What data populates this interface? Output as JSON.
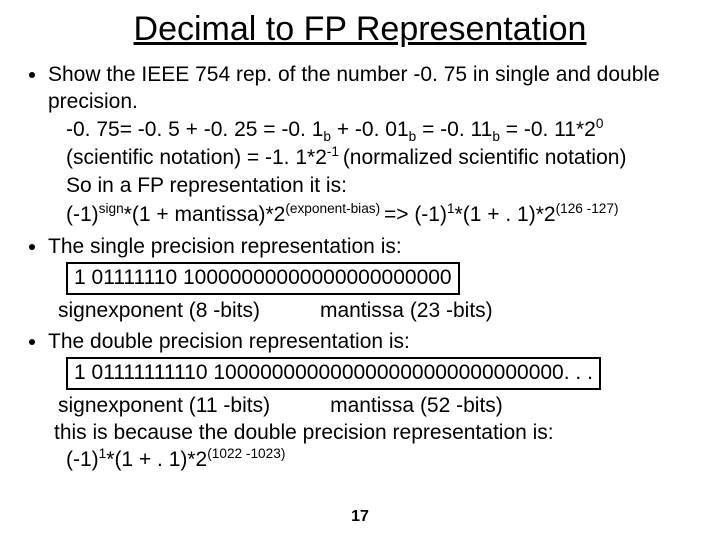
{
  "title": "Decimal to FP Representation",
  "b1": {
    "intro": "Show the IEEE 754 rep. of the number -0. 75 in single and double precision.",
    "line2a": "-0. 75= -0. 5 + -0. 25 = -0. 1",
    "line2b": " + -0. 01",
    "line2c": " = -0. 11",
    "line2d": " = -0. 11*2",
    "exp0": "0",
    "line3a": "(scientific notation) = -1. 1*2",
    "expNeg1": "-1 ",
    "line3b": "(normalized scientific notation)",
    "line4": "So in a FP representation it is:",
    "line5a": "(-1)",
    "supSign": "sign",
    "line5b": "*(1 + mantissa)*2",
    "supExpBias": "(exponent-bias) ",
    "line5c": "=> ",
    "line5d": "(-1)",
    "sup1": "1",
    "line5e": "*(1 + . 1)*2",
    "sup126": "(126 -127)"
  },
  "b2": {
    "intro": "The single precision representation is:",
    "bits": "1 01111110 10000000000000000000000",
    "signLbl": "sign ",
    "expLbl": "exponent (8 -bits)",
    "manLbl": "mantissa (23 -bits)"
  },
  "b3": {
    "intro": "The double precision representation is:",
    "bits": "1 01111111110 100000000000000000000000000000. . .",
    "signLbl": "sign ",
    "expLbl": "exponent (11 -bits)",
    "manLbl": "mantissa (52 -bits)",
    "because": "this is because the double precision representation is:",
    "formA": "(-1)",
    "sup1": "1",
    "formB": "*(1 + . 1)*2",
    "sup1022": "(1022 -1023)"
  },
  "page": "17",
  "glyph_b": "b"
}
